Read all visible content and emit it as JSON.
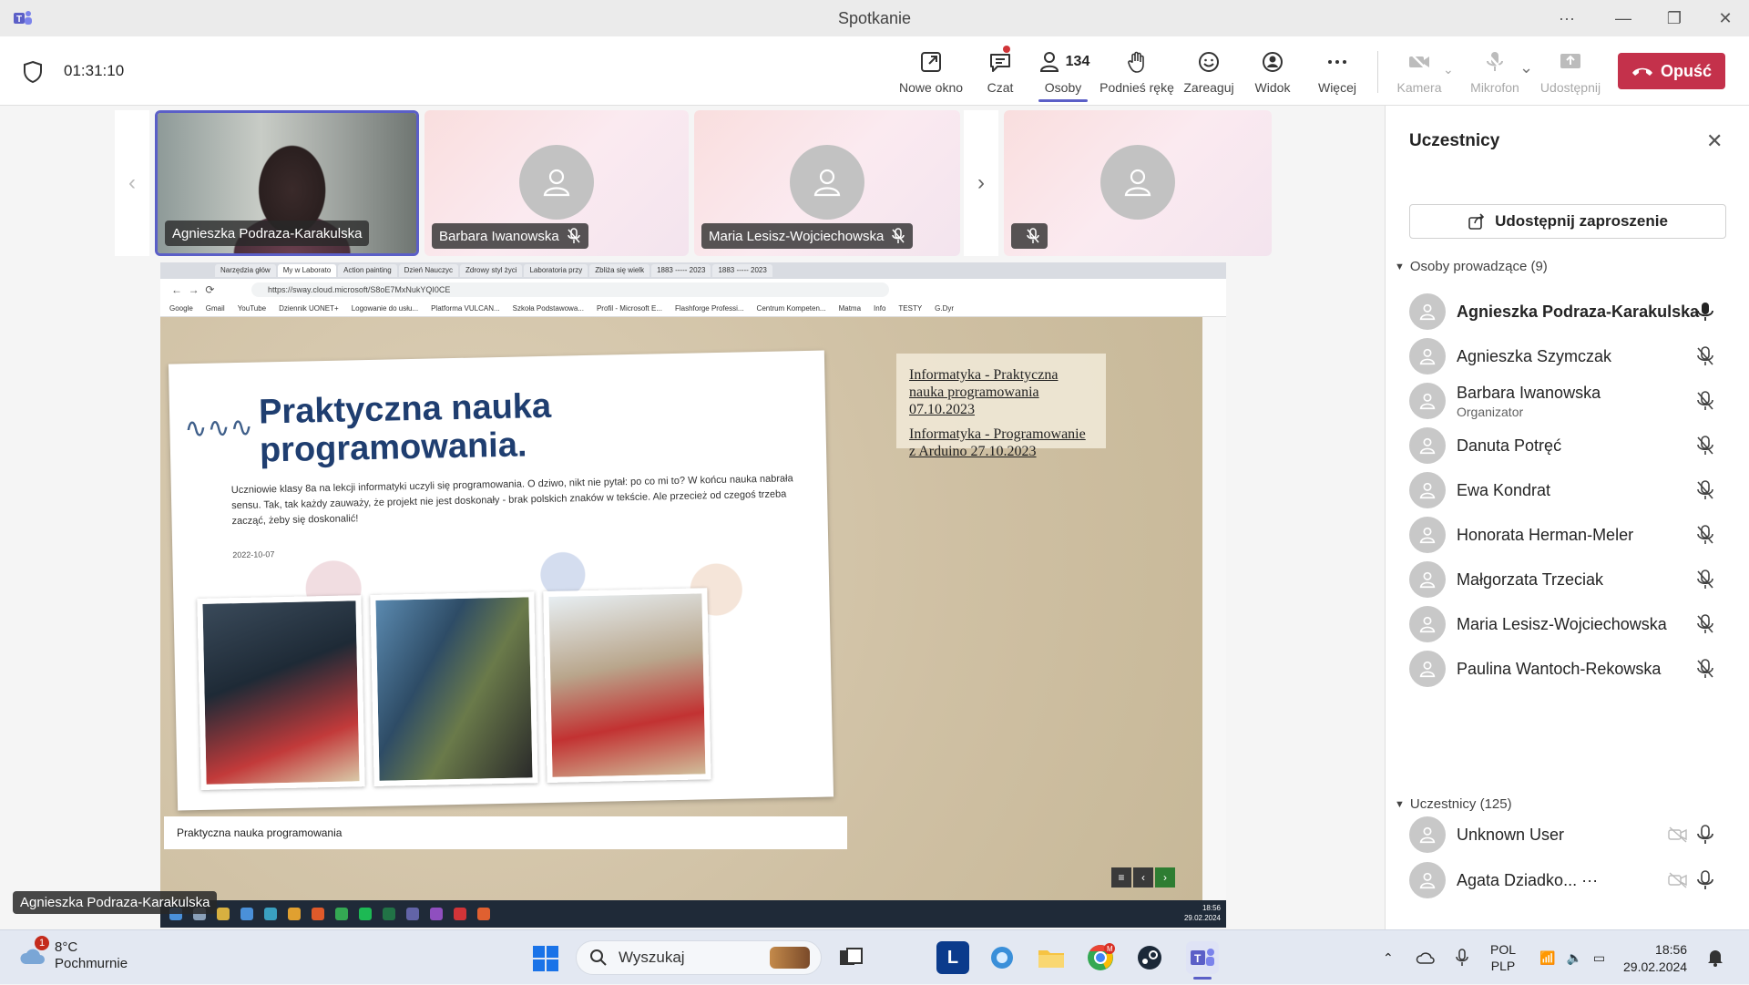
{
  "window": {
    "title": "Spotkanie"
  },
  "toolbar": {
    "timer": "01:31:10",
    "buttons": {
      "new_window": "Nowe okno",
      "chat": "Czat",
      "people": "Osoby",
      "people_count": "134",
      "raise_hand": "Podnieś rękę",
      "react": "Zareaguj",
      "view": "Widok",
      "more": "Więcej",
      "camera": "Kamera",
      "mic": "Mikrofon",
      "share": "Udostępnij",
      "leave": "Opuść"
    }
  },
  "video_tiles": [
    {
      "name": "Agnieszka Podraza-Karakulska"
    },
    {
      "name": "Barbara Iwanowska"
    },
    {
      "name": "Maria Lesisz-Wojciechowska"
    },
    {
      "name": ""
    }
  ],
  "shared_screen": {
    "url": "https://sway.cloud.microsoft/S8oE7MxNukYQI0CE",
    "tabs": [
      "Narzędzia głów",
      "My w Laborato",
      "Action painting",
      "Dzień Nauczyc",
      "Zdrowy styl życi",
      "Laboratoria przy",
      "Zbliża się wielk",
      "1883 ----- 2023",
      "1883 ----- 2023"
    ],
    "bookmarks": [
      "Google",
      "Gmail",
      "YouTube",
      "Dziennik UONET+",
      "Logowanie do usłu...",
      "Platforma VULCAN...",
      "Szkoła Podstawowa...",
      "Profil - Microsoft E...",
      "Flashforge Professi...",
      "Centrum Kompeten...",
      "Matma",
      "Info",
      "TESTY",
      "G.Dyr"
    ],
    "sway_title": "Praktyczna nauka programowania.",
    "sway_text": "Uczniowie klasy 8a na lekcji informatyki uczyli się programowania. O dziwo, nikt nie pytał: po co mi to? W końcu nauka nabrała sensu. Tak, tak każdy zauważy, że projekt nie jest doskonały - brak polskich znaków w tekście. Ale przecież od czegoś trzeba zacząć, żeby się doskonalić!",
    "sway_date": "2022-10-07",
    "caption": "Praktyczna nauka programowania",
    "links": [
      "Informatyka - Praktyczna nauka programowania 07.10.2023",
      "Informatyka - Programowanie z Arduino 27.10.2023"
    ],
    "inner_clock_time": "18:56",
    "inner_clock_date": "29.02.2024"
  },
  "speaker_label": "Agnieszka Podraza-Karakulska",
  "panel": {
    "title": "Uczestnicy",
    "invite_label": "Udostępnij zaproszenie",
    "presenters_header": "Osoby prowadzące (9)",
    "presenters": [
      {
        "name": "Agnieszka Podraza-Karakulska",
        "role": ""
      },
      {
        "name": "Agnieszka Szymczak",
        "role": ""
      },
      {
        "name": "Barbara Iwanowska",
        "role": "Organizator"
      },
      {
        "name": "Danuta Potręć",
        "role": ""
      },
      {
        "name": "Ewa Kondrat",
        "role": ""
      },
      {
        "name": "Honorata Herman-Meler",
        "role": ""
      },
      {
        "name": "Małgorzata Trzeciak",
        "role": ""
      },
      {
        "name": "Maria Lesisz-Wojciechowska",
        "role": ""
      },
      {
        "name": "Paulina Wantoch-Rekowska",
        "role": ""
      }
    ],
    "attendees_header": "Uczestnicy (125)",
    "attendees": [
      {
        "name": "Unknown User"
      },
      {
        "name": "Agata Dziadko... ···"
      }
    ]
  },
  "taskbar": {
    "weather_temp": "8°C",
    "weather_desc": "Pochmurnie",
    "weather_badge": "1",
    "search_placeholder": "Wyszukaj",
    "lang_top": "POL",
    "lang_bottom": "PLP",
    "time": "18:56",
    "date": "29.02.2024"
  },
  "colors": {
    "accent": "#5b5fc7",
    "leave": "#c4314b"
  }
}
